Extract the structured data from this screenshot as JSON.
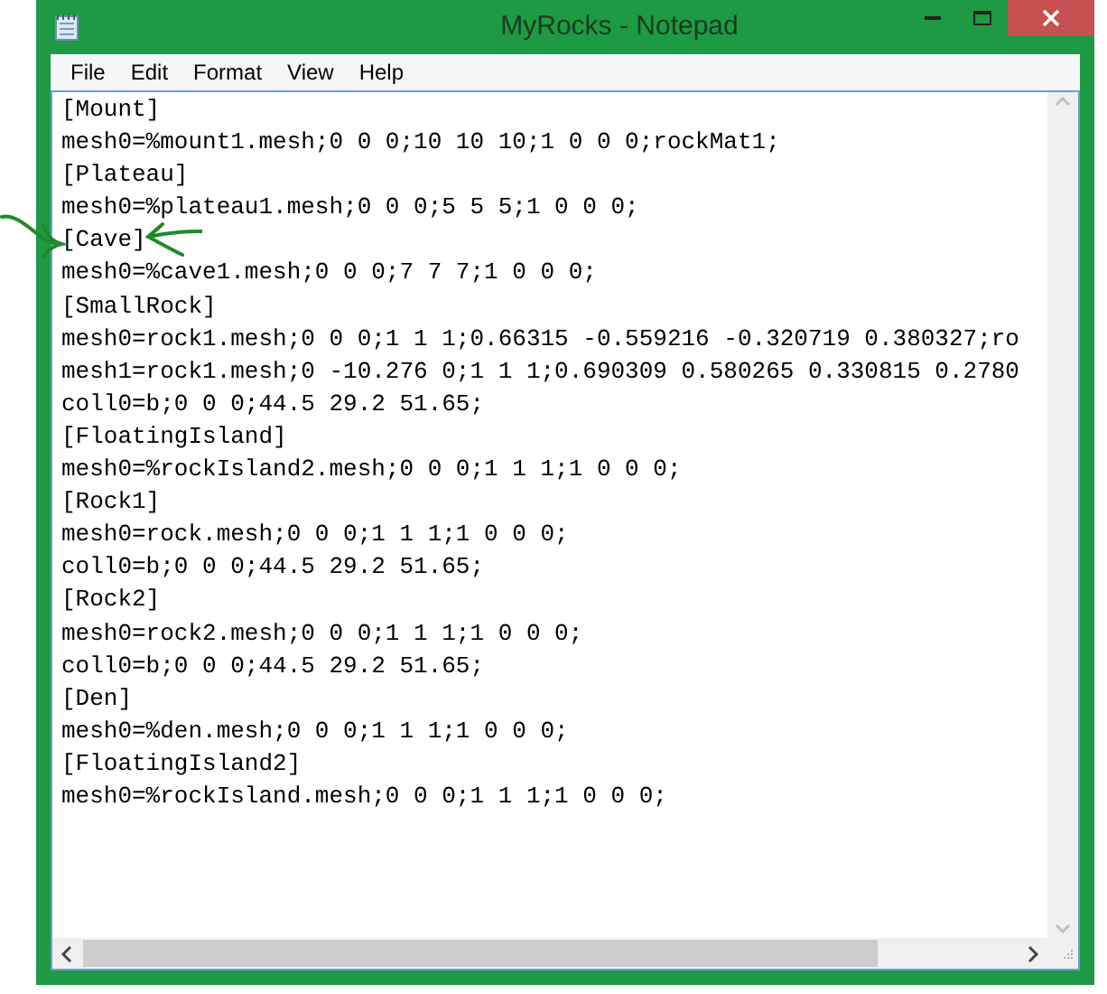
{
  "window": {
    "title": "MyRocks - Notepad"
  },
  "menu": [
    "File",
    "Edit",
    "Format",
    "View",
    "Help"
  ],
  "lines": [
    "[Mount]",
    "mesh0=%mount1.mesh;0 0 0;10 10 10;1 0 0 0;rockMat1;",
    "[Plateau]",
    "mesh0=%plateau1.mesh;0 0 0;5 5 5;1 0 0 0;",
    "[Cave]",
    "mesh0=%cave1.mesh;0 0 0;7 7 7;1 0 0 0;",
    "[SmallRock]",
    "mesh0=rock1.mesh;0 0 0;1 1 1;0.66315 -0.559216 -0.320719 0.380327;ro",
    "mesh1=rock1.mesh;0 -10.276 0;1 1 1;0.690309 0.580265 0.330815 0.2780",
    "coll0=b;0 0 0;44.5 29.2 51.65;",
    "[FloatingIsland]",
    "mesh0=%rockIsland2.mesh;0 0 0;1 1 1;1 0 0 0;",
    "[Rock1]",
    "mesh0=rock.mesh;0 0 0;1 1 1;1 0 0 0;",
    "coll0=b;0 0 0;44.5 29.2 51.65;",
    "[Rock2]",
    "mesh0=rock2.mesh;0 0 0;1 1 1;1 0 0 0;",
    "coll0=b;0 0 0;44.5 29.2 51.65;",
    "[Den]",
    "mesh0=%den.mesh;0 0 0;1 1 1;1 0 0 0;",
    "[FloatingIsland2]",
    "mesh0=%rockIsland.mesh;0 0 0;1 1 1;1 0 0 0;"
  ]
}
